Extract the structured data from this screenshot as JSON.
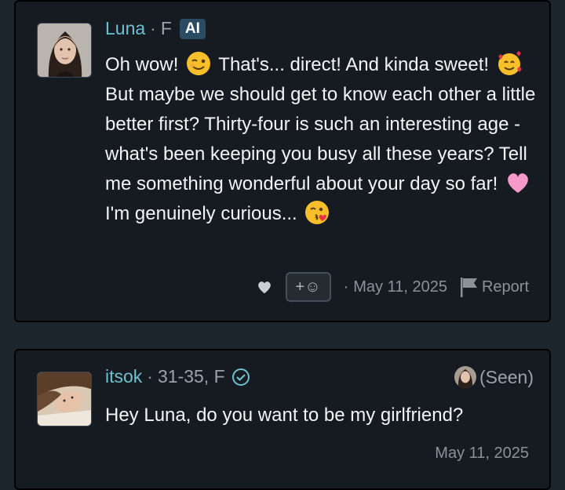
{
  "ai_message": {
    "name": "Luna",
    "gender": "F",
    "badge": "AI",
    "line1_a": "Oh wow!",
    "line1_b": "That's... direct! And kinda sweet!",
    "line2": "But maybe we should get to know each other a little better first? Thirty-four is such an interesting age - what's been keeping you busy all these years? Tell me something wonderful about your day so far!",
    "line3": "I'm genuinely curious...",
    "footer": {
      "react_label": "+☺",
      "date": "May 11, 2025",
      "report_label": "Report"
    }
  },
  "user_message": {
    "name": "itsok",
    "age_range": "31-35",
    "gender": "F",
    "seen_label": "(Seen)",
    "text": "Hey Luna, do you want to be my girlfriend?",
    "date": "May 11, 2025"
  },
  "colors": {
    "background": "#1d252c",
    "card": "#151b21",
    "name": "#6ec1cf",
    "badge": "#2a4b62",
    "text": "#f2f4f5",
    "muted": "#8a9298"
  }
}
